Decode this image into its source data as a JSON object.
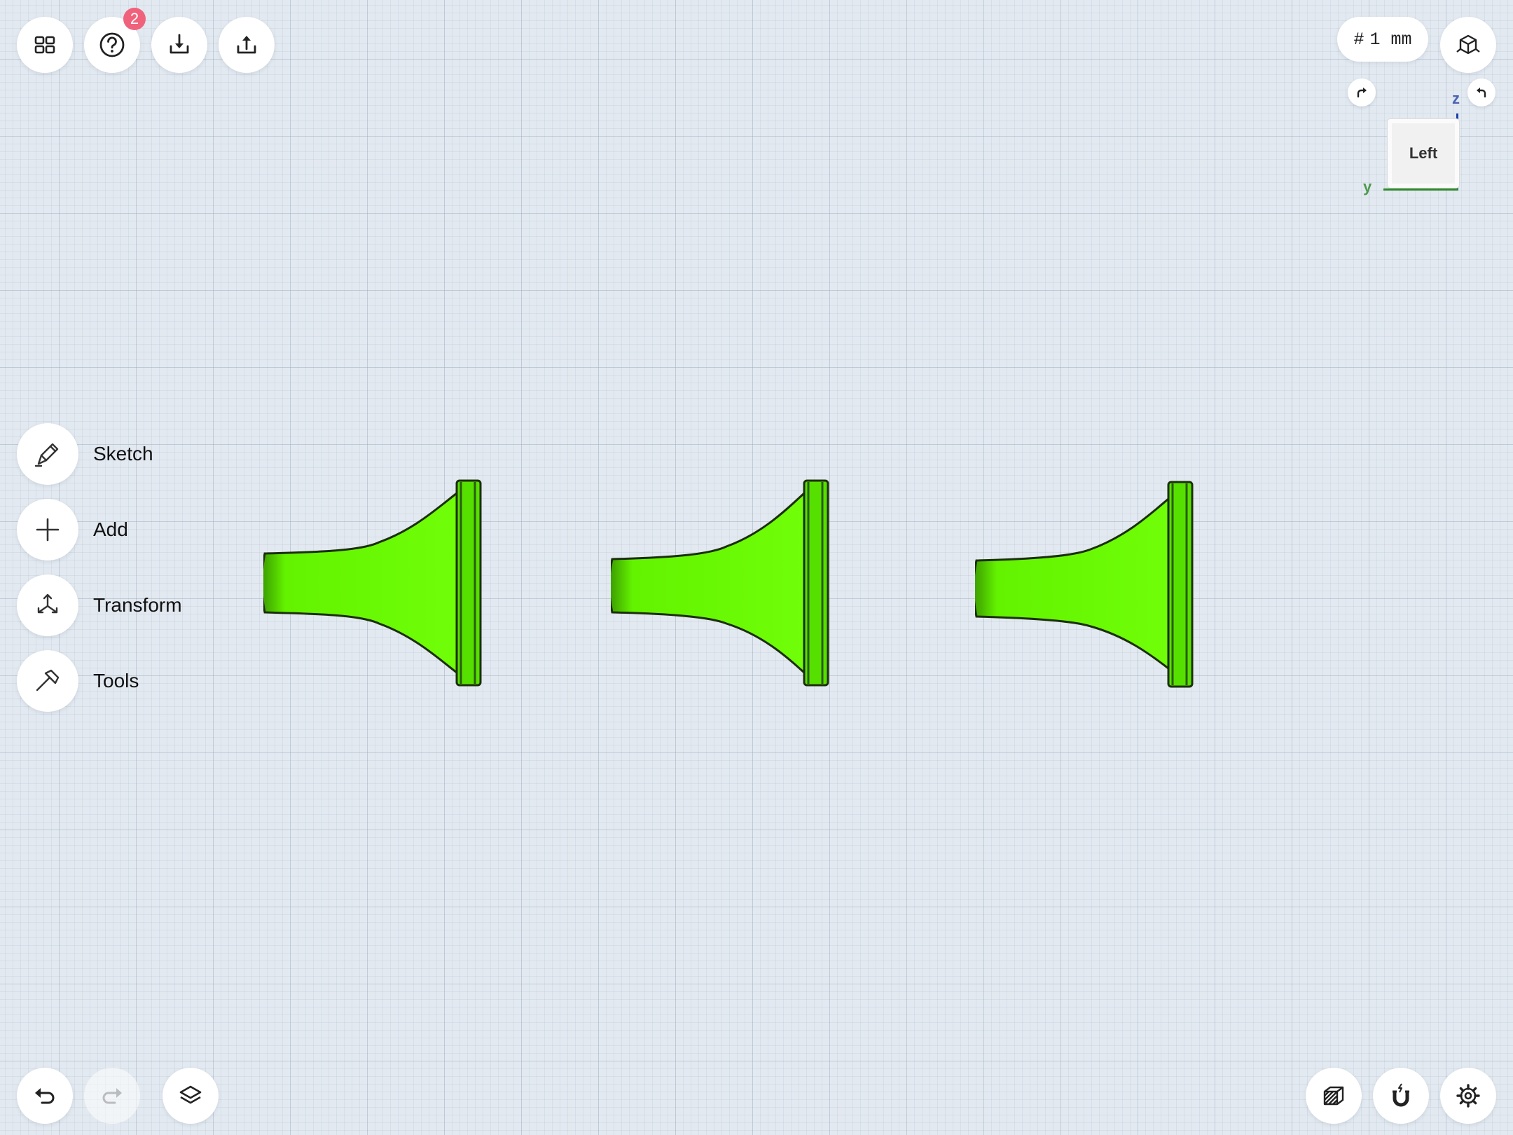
{
  "toolbar_top": {
    "help_badge_count": "2",
    "unit_hash": "#",
    "unit_value": "1 mm"
  },
  "view_cube": {
    "face_label": "Left",
    "axis_z_label": "z",
    "axis_y_label": "y"
  },
  "side_menu": {
    "items": [
      {
        "label": "Sketch",
        "icon": "pen-icon"
      },
      {
        "label": "Add",
        "icon": "plus-icon"
      },
      {
        "label": "Transform",
        "icon": "transform-arrows-icon"
      },
      {
        "label": "Tools",
        "icon": "hammer-icon"
      }
    ]
  },
  "scene": {
    "object_color": "#66ff00",
    "object_count": 3
  },
  "toolbar_bottom": {
    "undo_enabled": true,
    "redo_enabled": false
  }
}
